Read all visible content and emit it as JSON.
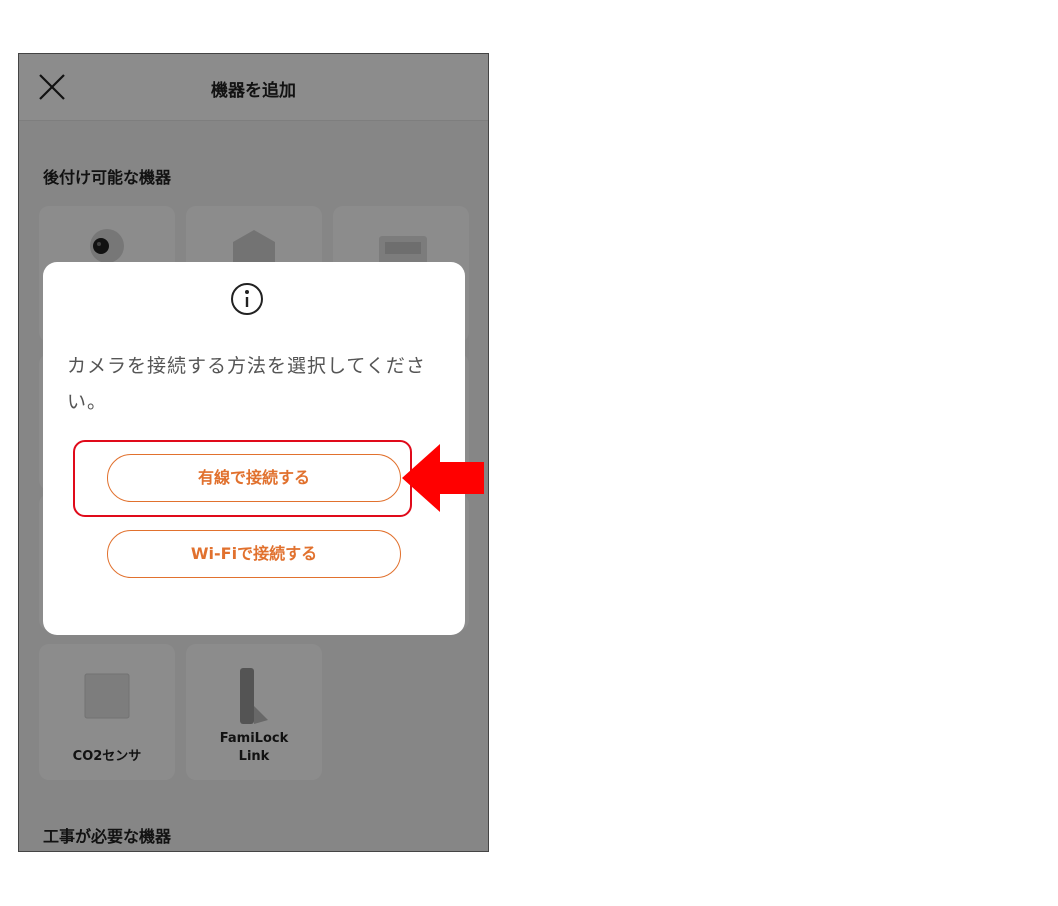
{
  "header": {
    "title": "機器を追加"
  },
  "sections": {
    "retrofit_title": "後付け可能な機器",
    "construction_title": "工事が必要な機器"
  },
  "devices": [
    {
      "label": "CO2センサ"
    },
    {
      "label": "FamiLock\nLink"
    }
  ],
  "dialog": {
    "message": "カメラを接続する方法を選択してください。",
    "wired_button": "有線で接続する",
    "wifi_button": "Wi-Fiで接続する"
  },
  "colors": {
    "accent": "#e1712e",
    "highlight": "#e00a1a",
    "arrow": "#ff0000"
  },
  "icons": [
    "close-icon",
    "info-icon",
    "camera-icon",
    "hub-icon",
    "panel-icon",
    "co2-sensor-icon",
    "familock-link-icon",
    "red-arrow-icon"
  ]
}
